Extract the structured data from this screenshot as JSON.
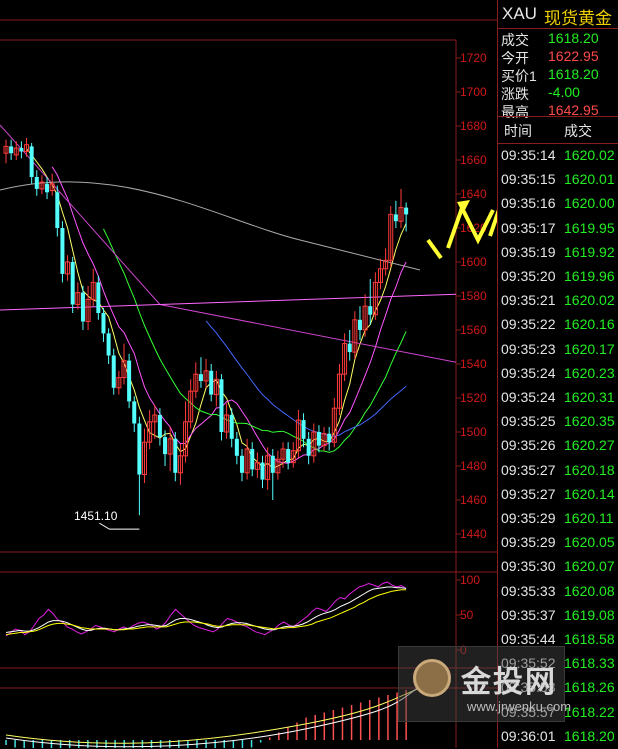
{
  "quote": {
    "symbol": "XAU",
    "name": "现货黄金",
    "rows": [
      {
        "label": "成交",
        "value": "1618.20",
        "color": "#22ee22"
      },
      {
        "label": "今开",
        "value": "1622.95",
        "color": "#ff4a4a"
      },
      {
        "label": "买价1",
        "value": "1618.20",
        "color": "#22ee22"
      },
      {
        "label": "涨跌",
        "value": "-4.00",
        "color": "#22ee22"
      },
      {
        "label": "最高",
        "value": "1642.95",
        "color": "#ff4a4a"
      }
    ],
    "ticks_header": {
      "time": "时间",
      "price": "成交"
    },
    "ticks": [
      {
        "time": "09:35:14",
        "price": "1620.02"
      },
      {
        "time": "09:35:15",
        "price": "1620.01"
      },
      {
        "time": "09:35:16",
        "price": "1620.00"
      },
      {
        "time": "09:35:17",
        "price": "1619.95"
      },
      {
        "time": "09:35:19",
        "price": "1619.92"
      },
      {
        "time": "09:35:20",
        "price": "1619.96"
      },
      {
        "time": "09:35:21",
        "price": "1620.02"
      },
      {
        "time": "09:35:22",
        "price": "1620.16"
      },
      {
        "time": "09:35:23",
        "price": "1620.17"
      },
      {
        "time": "09:35:24",
        "price": "1620.23"
      },
      {
        "time": "09:35:24",
        "price": "1620.31"
      },
      {
        "time": "09:35:25",
        "price": "1620.35"
      },
      {
        "time": "09:35:26",
        "price": "1620.27"
      },
      {
        "time": "09:35:27",
        "price": "1620.18"
      },
      {
        "time": "09:35:27",
        "price": "1620.14"
      },
      {
        "time": "09:35:29",
        "price": "1620.11"
      },
      {
        "time": "09:35:29",
        "price": "1620.05"
      },
      {
        "time": "09:35:30",
        "price": "1620.07"
      },
      {
        "time": "09:35:33",
        "price": "1620.08"
      },
      {
        "time": "09:35:37",
        "price": "1619.08"
      },
      {
        "time": "09:35:44",
        "price": "1618.58"
      },
      {
        "time": "09:35:52",
        "price": "1618.33"
      },
      {
        "time": "09:35:53",
        "price": "1618.26"
      },
      {
        "time": "09:35:57",
        "price": "1618.22"
      },
      {
        "time": "09:36:01",
        "price": "1618.20"
      }
    ]
  },
  "watermark": {
    "text": "金投网",
    "url": "www.jrwenku.com"
  },
  "chart_data": [
    {
      "type": "candlestick",
      "grid": false,
      "y_ticks": [
        "1720",
        "1700",
        "1680",
        "1660",
        "1640",
        "1620",
        "1600",
        "1580",
        "1560",
        "1540",
        "1520",
        "1500",
        "1480",
        "1460",
        "1440"
      ],
      "ylim": [
        1436,
        1725
      ],
      "annotation": {
        "text": "1451.10",
        "value": 1451.1
      },
      "candles": [
        {
          "o": 1664,
          "c": 1668,
          "h": 1672,
          "l": 1658
        },
        {
          "o": 1668,
          "c": 1664,
          "h": 1672,
          "l": 1660
        },
        {
          "o": 1663,
          "c": 1667,
          "h": 1671,
          "l": 1660
        },
        {
          "o": 1667,
          "c": 1665,
          "h": 1671,
          "l": 1661
        },
        {
          "o": 1665,
          "c": 1669,
          "h": 1673,
          "l": 1662
        },
        {
          "o": 1668,
          "c": 1650,
          "h": 1670,
          "l": 1646
        },
        {
          "o": 1650,
          "c": 1643,
          "h": 1654,
          "l": 1639
        },
        {
          "o": 1643,
          "c": 1647,
          "h": 1651,
          "l": 1640
        },
        {
          "o": 1646,
          "c": 1641,
          "h": 1650,
          "l": 1637
        },
        {
          "o": 1642,
          "c": 1646,
          "h": 1652,
          "l": 1639
        },
        {
          "o": 1641,
          "c": 1620,
          "h": 1645,
          "l": 1615
        },
        {
          "o": 1620,
          "c": 1593,
          "h": 1624,
          "l": 1588
        },
        {
          "o": 1593,
          "c": 1600,
          "h": 1604,
          "l": 1589
        },
        {
          "o": 1600,
          "c": 1575,
          "h": 1603,
          "l": 1570
        },
        {
          "o": 1575,
          "c": 1582,
          "h": 1588,
          "l": 1572
        },
        {
          "o": 1582,
          "c": 1565,
          "h": 1586,
          "l": 1560
        },
        {
          "o": 1565,
          "c": 1578,
          "h": 1586,
          "l": 1560
        },
        {
          "o": 1578,
          "c": 1588,
          "h": 1596,
          "l": 1574
        },
        {
          "o": 1588,
          "c": 1570,
          "h": 1592,
          "l": 1566
        },
        {
          "o": 1570,
          "c": 1558,
          "h": 1573,
          "l": 1553
        },
        {
          "o": 1558,
          "c": 1545,
          "h": 1561,
          "l": 1540
        },
        {
          "o": 1545,
          "c": 1526,
          "h": 1549,
          "l": 1522
        },
        {
          "o": 1526,
          "c": 1532,
          "h": 1536,
          "l": 1522
        },
        {
          "o": 1532,
          "c": 1542,
          "h": 1552,
          "l": 1528
        },
        {
          "o": 1542,
          "c": 1518,
          "h": 1546,
          "l": 1514
        },
        {
          "o": 1518,
          "c": 1505,
          "h": 1521,
          "l": 1500
        },
        {
          "o": 1505,
          "c": 1475,
          "h": 1509,
          "l": 1451
        },
        {
          "o": 1475,
          "c": 1494,
          "h": 1502,
          "l": 1470
        },
        {
          "o": 1494,
          "c": 1506,
          "h": 1513,
          "l": 1490
        },
        {
          "o": 1506,
          "c": 1510,
          "h": 1516,
          "l": 1496
        },
        {
          "o": 1510,
          "c": 1497,
          "h": 1514,
          "l": 1492
        },
        {
          "o": 1497,
          "c": 1487,
          "h": 1501,
          "l": 1480
        },
        {
          "o": 1487,
          "c": 1496,
          "h": 1503,
          "l": 1477
        },
        {
          "o": 1496,
          "c": 1476,
          "h": 1500,
          "l": 1471
        },
        {
          "o": 1476,
          "c": 1486,
          "h": 1493,
          "l": 1469
        },
        {
          "o": 1486,
          "c": 1506,
          "h": 1518,
          "l": 1482
        },
        {
          "o": 1506,
          "c": 1524,
          "h": 1531,
          "l": 1502
        },
        {
          "o": 1524,
          "c": 1534,
          "h": 1541,
          "l": 1520
        },
        {
          "o": 1534,
          "c": 1530,
          "h": 1544,
          "l": 1526
        },
        {
          "o": 1530,
          "c": 1536,
          "h": 1543,
          "l": 1526
        },
        {
          "o": 1536,
          "c": 1522,
          "h": 1540,
          "l": 1518
        },
        {
          "o": 1522,
          "c": 1531,
          "h": 1536,
          "l": 1515
        },
        {
          "o": 1531,
          "c": 1500,
          "h": 1534,
          "l": 1495
        },
        {
          "o": 1500,
          "c": 1510,
          "h": 1517,
          "l": 1496
        },
        {
          "o": 1510,
          "c": 1496,
          "h": 1514,
          "l": 1491
        },
        {
          "o": 1496,
          "c": 1486,
          "h": 1500,
          "l": 1481
        },
        {
          "o": 1486,
          "c": 1476,
          "h": 1490,
          "l": 1471
        },
        {
          "o": 1476,
          "c": 1490,
          "h": 1496,
          "l": 1472
        },
        {
          "o": 1490,
          "c": 1478,
          "h": 1494,
          "l": 1474
        },
        {
          "o": 1478,
          "c": 1482,
          "h": 1488,
          "l": 1473
        },
        {
          "o": 1482,
          "c": 1472,
          "h": 1486,
          "l": 1467
        },
        {
          "o": 1472,
          "c": 1486,
          "h": 1491,
          "l": 1466
        },
        {
          "o": 1486,
          "c": 1476,
          "h": 1490,
          "l": 1460
        },
        {
          "o": 1476,
          "c": 1484,
          "h": 1489,
          "l": 1472
        },
        {
          "o": 1484,
          "c": 1490,
          "h": 1494,
          "l": 1479
        },
        {
          "o": 1490,
          "c": 1482,
          "h": 1494,
          "l": 1478
        },
        {
          "o": 1482,
          "c": 1489,
          "h": 1494,
          "l": 1479
        },
        {
          "o": 1489,
          "c": 1507,
          "h": 1513,
          "l": 1485
        },
        {
          "o": 1507,
          "c": 1496,
          "h": 1511,
          "l": 1491
        },
        {
          "o": 1496,
          "c": 1486,
          "h": 1500,
          "l": 1481
        },
        {
          "o": 1486,
          "c": 1500,
          "h": 1505,
          "l": 1482
        },
        {
          "o": 1500,
          "c": 1492,
          "h": 1504,
          "l": 1488
        },
        {
          "o": 1492,
          "c": 1499,
          "h": 1503,
          "l": 1489
        },
        {
          "o": 1499,
          "c": 1494,
          "h": 1503,
          "l": 1489
        },
        {
          "o": 1494,
          "c": 1514,
          "h": 1520,
          "l": 1491
        },
        {
          "o": 1514,
          "c": 1534,
          "h": 1540,
          "l": 1510
        },
        {
          "o": 1534,
          "c": 1552,
          "h": 1558,
          "l": 1530
        },
        {
          "o": 1552,
          "c": 1547,
          "h": 1560,
          "l": 1542
        },
        {
          "o": 1547,
          "c": 1566,
          "h": 1571,
          "l": 1543
        },
        {
          "o": 1566,
          "c": 1560,
          "h": 1574,
          "l": 1554
        },
        {
          "o": 1560,
          "c": 1574,
          "h": 1581,
          "l": 1556
        },
        {
          "o": 1574,
          "c": 1569,
          "h": 1590,
          "l": 1563
        },
        {
          "o": 1569,
          "c": 1588,
          "h": 1594,
          "l": 1566
        },
        {
          "o": 1588,
          "c": 1596,
          "h": 1602,
          "l": 1584
        },
        {
          "o": 1596,
          "c": 1601,
          "h": 1608,
          "l": 1592
        },
        {
          "o": 1601,
          "c": 1628,
          "h": 1633,
          "l": 1597
        },
        {
          "o": 1628,
          "c": 1624,
          "h": 1636,
          "l": 1620
        },
        {
          "o": 1624,
          "c": 1632,
          "h": 1643,
          "l": 1620
        },
        {
          "o": 1632,
          "c": 1628,
          "h": 1635,
          "l": 1618
        }
      ]
    },
    {
      "type": "line",
      "y_ticks": [
        "100",
        "50",
        "0"
      ],
      "ylim": [
        0,
        100
      ],
      "series": [
        {
          "color": "#e020e0",
          "values": [
            20,
            25,
            30,
            28,
            22,
            26,
            35,
            45,
            50,
            58,
            52,
            43,
            40,
            33,
            30,
            26,
            23,
            26,
            30,
            35,
            33,
            30,
            28,
            26,
            30,
            33,
            30,
            35,
            38,
            40,
            38,
            35,
            30,
            33,
            40,
            50,
            58,
            52,
            46,
            40,
            35,
            32,
            30,
            28,
            26,
            30,
            38,
            45,
            43,
            40,
            36,
            34,
            30,
            26,
            24,
            22,
            26,
            30,
            36,
            40,
            36,
            33,
            38,
            43,
            48,
            55,
            60,
            58,
            55,
            62,
            70,
            75,
            73,
            80,
            85,
            90,
            92,
            95,
            93,
            90,
            95,
            97,
            93,
            90,
            92,
            88
          ]
        },
        {
          "color": "#ffffff",
          "values": [
            25,
            26,
            27,
            28,
            27,
            27,
            29,
            32,
            36,
            40,
            42,
            42,
            41,
            39,
            36,
            33,
            30,
            28,
            28,
            30,
            31,
            31,
            30,
            29,
            29,
            30,
            31,
            32,
            34,
            35,
            36,
            36,
            35,
            34,
            35,
            39,
            43,
            45,
            45,
            44,
            42,
            40,
            38,
            35,
            33,
            32,
            33,
            36,
            38,
            39,
            39,
            38,
            36,
            34,
            32,
            30,
            29,
            29,
            31,
            33,
            34,
            34,
            35,
            37,
            40,
            44,
            48,
            51,
            53,
            55,
            58,
            62,
            65,
            68,
            72,
            76,
            80,
            84,
            87,
            88,
            89,
            90,
            90,
            89,
            89,
            88
          ]
        },
        {
          "color": "#ffff00",
          "values": [
            22,
            23,
            24,
            25,
            25,
            26,
            27,
            29,
            32,
            35,
            37,
            38,
            38,
            37,
            36,
            34,
            32,
            31,
            30,
            30,
            30,
            30,
            30,
            29,
            29,
            29,
            30,
            30,
            31,
            32,
            33,
            33,
            33,
            33,
            33,
            35,
            37,
            39,
            40,
            40,
            40,
            39,
            38,
            37,
            35,
            34,
            34,
            35,
            36,
            36,
            36,
            36,
            35,
            34,
            33,
            32,
            31,
            30,
            31,
            31,
            32,
            32,
            33,
            34,
            35,
            37,
            40,
            42,
            44,
            46,
            49,
            52,
            55,
            58,
            61,
            65,
            68,
            72,
            75,
            78,
            80,
            82,
            84,
            85,
            86,
            86
          ]
        }
      ]
    },
    {
      "type": "bar",
      "ylim": [
        -2,
        2
      ],
      "values": [
        -0.2,
        -0.3,
        -0.4,
        -0.6,
        -0.8,
        -0.9,
        -1.0,
        -1.1,
        -1.2,
        -1.3,
        -1.4,
        -1.5,
        -1.6,
        -1.7,
        -1.8,
        -1.9,
        -1.9,
        -2.0,
        -1.9,
        -1.8,
        -1.7,
        -1.5,
        -1.3,
        -1.1,
        -0.9,
        -0.7,
        -0.5,
        -0.3,
        -0.1,
        0.1,
        0.3,
        0.5,
        0.7,
        0.9,
        1.0,
        1.1,
        1.2,
        1.3,
        1.4,
        1.5,
        1.6,
        1.7,
        1.8,
        1.9,
        2.0
      ]
    }
  ]
}
